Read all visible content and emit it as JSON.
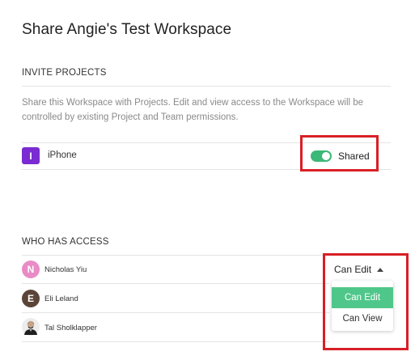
{
  "dialog": {
    "title": "Share Angie's Test Workspace"
  },
  "invite_projects": {
    "heading": "INVITE PROJECTS",
    "description": "Share this Workspace with Projects. Edit and view access to the Workspace will be controlled by existing Project and Team permissions.",
    "projects": [
      {
        "initial": "I",
        "name": "iPhone",
        "badge_color": "#7a2bd1",
        "shared": true,
        "status_label": "Shared"
      }
    ]
  },
  "access": {
    "heading": "WHO HAS ACCESS",
    "users": [
      {
        "initial": "N",
        "name": "Nicholas Yiu",
        "avatar_color": "#e98bc6",
        "permission": "Can Edit"
      },
      {
        "initial": "E",
        "name": "Eli Leland",
        "avatar_color": "#5b4438"
      },
      {
        "name": "Tal Sholklapper",
        "avatar_type": "photo"
      }
    ],
    "permission_dropdown": {
      "current": "Can Edit",
      "options": [
        "Can Edit",
        "Can View"
      ],
      "highlighted": "Can Edit"
    }
  },
  "colors": {
    "toggle_on": "#3cb878",
    "menu_highlight": "#4fc78a",
    "annotation_red": "#d81f26"
  }
}
